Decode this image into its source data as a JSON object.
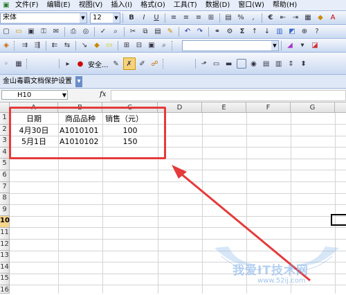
{
  "menu": [
    "文件(F)",
    "编辑(E)",
    "视图(V)",
    "插入(I)",
    "格式(O)",
    "工具(T)",
    "数据(D)",
    "窗口(W)",
    "帮助(H)"
  ],
  "format_bar": {
    "font": "宋体",
    "size": "12",
    "bold": "B",
    "italic": "I",
    "underline": "U",
    "percent": "%",
    "comma": ",",
    "currency": "€"
  },
  "standard_bar": {
    "sum": "Σ"
  },
  "macro_bar": {
    "security_label": "安全..."
  },
  "addin_bar": {
    "label": "金山毒霸文档保护设置"
  },
  "formula_bar": {
    "name_box": "H10",
    "fx": "fx"
  },
  "sheet": {
    "columns": [
      "A",
      "B",
      "C",
      "D",
      "E",
      "F",
      "G"
    ],
    "rows": [
      "1",
      "2",
      "3",
      "4",
      "5",
      "6",
      "7",
      "8",
      "9",
      "10",
      "11",
      "12",
      "13",
      "14",
      "15",
      "16"
    ],
    "active_row": "10",
    "cells": {
      "A1": "日期",
      "B1": "商品品种",
      "C1": "销售（元）",
      "A2": "4月30日",
      "B2": "A1010101",
      "C2": "100",
      "A3": "5月1日",
      "B3": "A1010102",
      "C3": "150"
    }
  },
  "watermark": {
    "title": "我爱IT技术网",
    "url": "www.52ij.com"
  },
  "colors": {
    "annotation": "#e53a3a",
    "toolbar": "#c9d9f1"
  }
}
